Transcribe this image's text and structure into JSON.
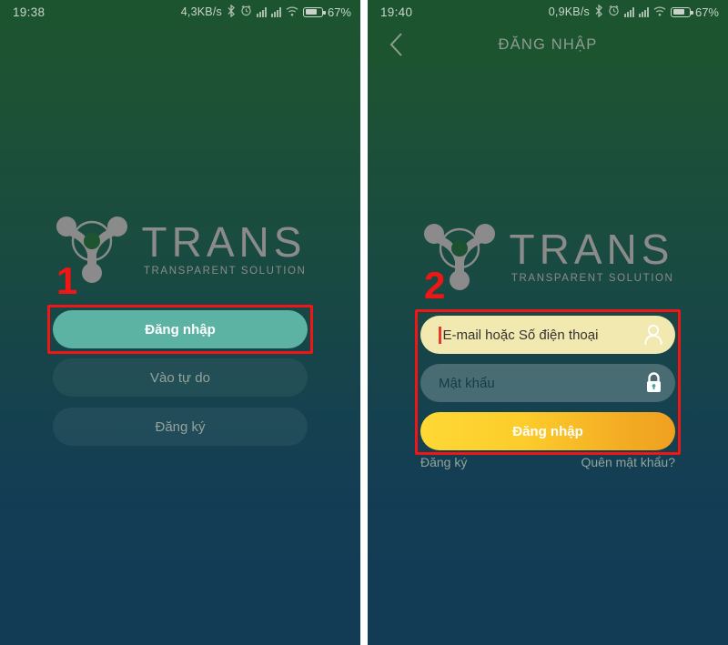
{
  "screens": [
    {
      "id": "welcome",
      "statusbar": {
        "clock": "19:38",
        "netspeed": "4,3KB/s",
        "battery_percent": "67%",
        "icons": [
          "bluetooth-icon",
          "alarm-icon",
          "signal-icon",
          "signal-icon",
          "wifi-icon",
          "battery-icon"
        ]
      },
      "logo": {
        "brand": "TRANS",
        "tagline": "TRANSPARENT SOLUTION"
      },
      "buttons": [
        {
          "label": "Đăng nhập",
          "style": "primary"
        },
        {
          "label": "Vào tự do",
          "style": "ghost"
        },
        {
          "label": "Đăng ký",
          "style": "ghost"
        }
      ],
      "marker": "1"
    },
    {
      "id": "login",
      "statusbar": {
        "clock": "19:40",
        "netspeed": "0,9KB/s",
        "battery_percent": "67%",
        "icons": [
          "bluetooth-icon",
          "alarm-icon",
          "signal-icon",
          "signal-icon",
          "wifi-icon",
          "battery-icon"
        ]
      },
      "appbar": {
        "title": "ĐĂNG NHẬP",
        "back": "back-chevron-icon"
      },
      "logo": {
        "brand": "TRANS",
        "tagline": "TRANSPARENT SOLUTION"
      },
      "form": {
        "email": {
          "placeholder": "E-mail hoặc Số điện thoại",
          "value": "",
          "icon": "user-icon"
        },
        "password": {
          "placeholder": "Mật khẩu",
          "value": "",
          "icon": "lock-icon"
        },
        "submit": "Đăng nhập"
      },
      "links": {
        "register": "Đăng ký",
        "forgot": "Quên mật khẩu?"
      },
      "marker": "2"
    }
  ],
  "colors": {
    "bg_top": "#1e5430",
    "bg_bottom": "#123c56",
    "statusbar": "#1d5430",
    "primary_button": "#5cb3a3",
    "email_field": "#f2e9b0",
    "submit_gradient_start": "#ffd836",
    "submit_gradient_end": "#efa01f",
    "highlight": "#f01616",
    "logo_gray": "#8b8b8b"
  }
}
